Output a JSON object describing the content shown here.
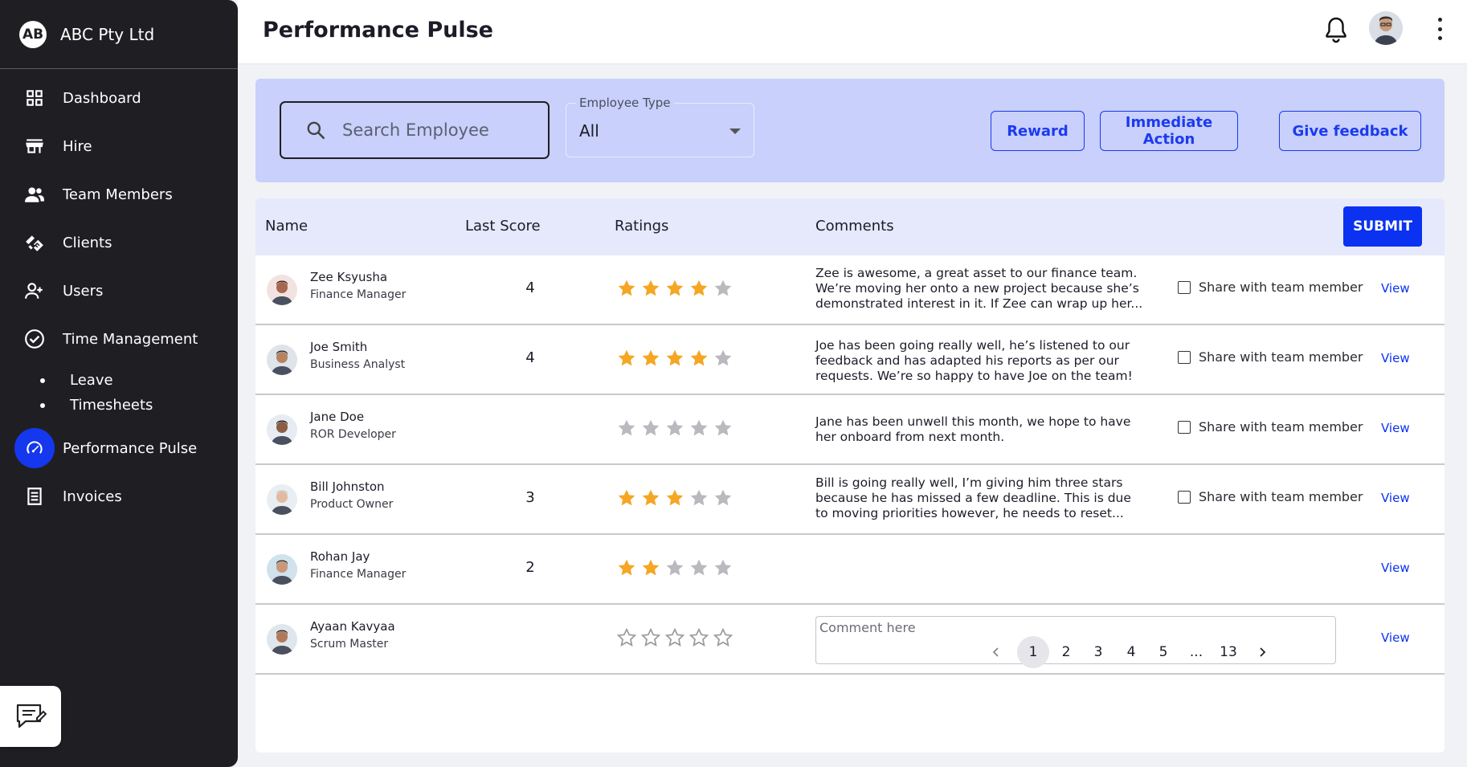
{
  "sidebar": {
    "logo_text": "AB",
    "company": "ABC Pty Ltd",
    "items": [
      {
        "label": "Dashboard"
      },
      {
        "label": "Hire"
      },
      {
        "label": "Team Members"
      },
      {
        "label": "Clients"
      },
      {
        "label": "Users"
      },
      {
        "label": "Time Management"
      }
    ],
    "sub_items": [
      {
        "label": "Leave"
      },
      {
        "label": "Timesheets"
      }
    ],
    "active_item": {
      "label": "Performance Pulse"
    },
    "last_item": {
      "label": "Invoices"
    }
  },
  "header": {
    "title": "Performance Pulse"
  },
  "filters": {
    "search_placeholder": "Search Employee",
    "employee_type_label": "Employee Type",
    "employee_type_value": "All",
    "reward_label": "Reward",
    "immediate_label": "Immediate Action",
    "feedback_label": "Give feedback"
  },
  "table": {
    "columns": {
      "name": "Name",
      "last_score": "Last Score",
      "ratings": "Ratings",
      "comments": "Comments"
    },
    "submit_label": "SUBMIT",
    "share_label": "Share with team member",
    "view_label": "View",
    "comment_placeholder": "Comment here",
    "rows": [
      {
        "name": "Zee Ksyusha",
        "role": "Finance Manager",
        "score": "4",
        "rating": 4,
        "comment": "Zee is awesome, a great asset to our finance team. We’re moving her onto a new project because she’s demonstrated interest in it. If Zee can wrap up her...",
        "share": true
      },
      {
        "name": "Joe Smith",
        "role": "Business Analyst",
        "score": "4",
        "rating": 4,
        "comment": "Joe has been going really well, he’s listened to our feedback and has adapted his reports as per our requests. We’re so happy to have Joe on the team!",
        "share": true
      },
      {
        "name": "Jane Doe",
        "role": "ROR Developer",
        "score": "",
        "rating": 0,
        "comment": "Jane has been unwell this month, we hope to have her onboard from next month.",
        "share": true
      },
      {
        "name": "Bill Johnston",
        "role": "Product Owner",
        "score": "3",
        "rating": 3,
        "comment": "Bill is going really well, I’m giving him three stars because he has missed a few deadline. This is due to moving priorities however, he needs to reset...",
        "share": true
      },
      {
        "name": "Rohan Jay",
        "role": "Finance Manager",
        "score": "2",
        "rating": 2,
        "comment": "",
        "share": false
      },
      {
        "name": "Ayaan Kavyaa",
        "role": "Scrum Master",
        "score": "",
        "rating": 0,
        "comment": "",
        "share": false,
        "editable": true
      }
    ]
  },
  "pagination": {
    "pages": [
      "1",
      "2",
      "3",
      "4",
      "5",
      "...",
      "13"
    ],
    "current": "1"
  },
  "colors": {
    "accent": "#0a32f0",
    "sidebar_bg": "#1f1f23",
    "filter_bg": "#c8d0fb",
    "star_filled": "#f5a623",
    "star_empty": "#b9b9be"
  }
}
